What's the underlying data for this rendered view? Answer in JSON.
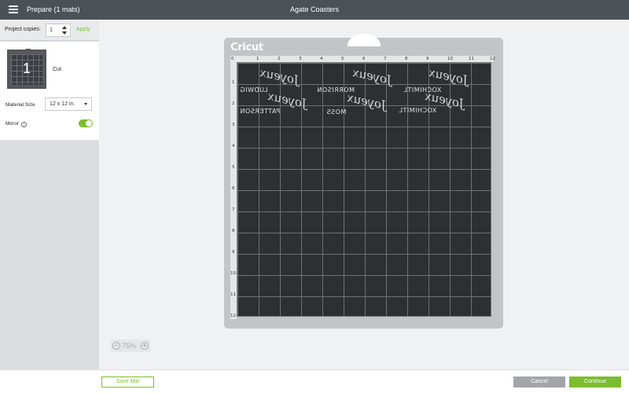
{
  "header": {
    "left_label": "Prepare (1 mats)",
    "title": "Agate Coasters",
    "menu_icon": "hamburger-menu-icon"
  },
  "sidebar": {
    "project_copies_label": "Project copies:",
    "project_copies_value": "1",
    "apply_label": "Apply",
    "mat_number": "1",
    "mat_operation": "Cut",
    "material_size_label": "Material Size",
    "material_size_value": "12 x 12 in.",
    "mirror_label": "Mirror",
    "mirror_info_glyph": "i",
    "mirror_enabled": true,
    "accent_color": "#7cbd2e"
  },
  "mat": {
    "brand": "Cricut",
    "ruler_ticks": [
      "0",
      "1",
      "2",
      "3",
      "4",
      "5",
      "6",
      "7",
      "8",
      "9",
      "10",
      "11",
      "12"
    ],
    "designs_text": [
      "LUDWIG",
      "MORRISON",
      "XOCHIMITL",
      "PATTERSON",
      "MOSS",
      "XOCHIMITL"
    ],
    "designs_script": [
      "Joyeux",
      "Joyeux",
      "Joyeux",
      "Joyeux",
      "Joyeux",
      "Joyeux"
    ]
  },
  "zoom": {
    "level": "75%",
    "minus": "−",
    "plus": "+"
  },
  "footer": {
    "save_label": "Save Mat",
    "cancel_label": "Cancel",
    "continue_label": "Continue"
  }
}
